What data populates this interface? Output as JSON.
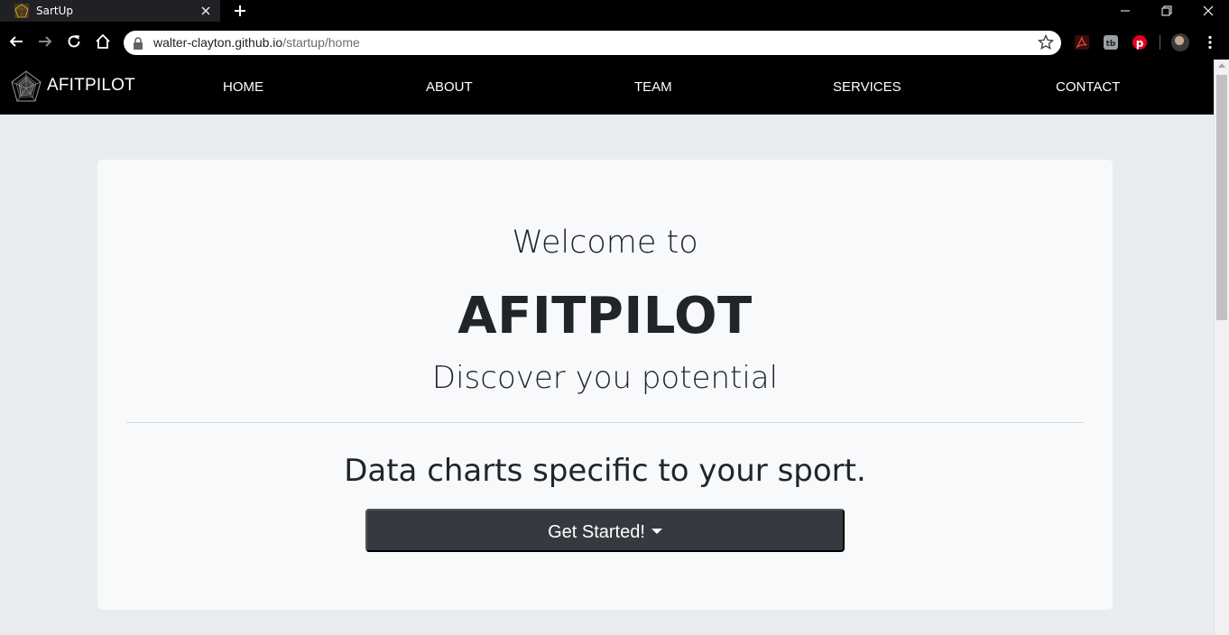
{
  "browser": {
    "tab_title": "SartUp",
    "url_host": "walter-clayton.github.io",
    "url_path": "/startup/home"
  },
  "icons": {
    "tab": [
      "site-favicon",
      "close-icon",
      "plus-icon"
    ],
    "window": [
      "minimize-icon",
      "restore-icon",
      "close-icon"
    ],
    "toolbar": [
      "back-arrow-icon",
      "forward-arrow-icon",
      "reload-icon",
      "home-icon",
      "lock-icon",
      "star-icon",
      "pdf-extension-icon",
      "tb-extension-icon",
      "pinterest-extension-icon",
      "avatar",
      "kebab-menu-icon"
    ],
    "brand": "pentagon-radar-logo"
  },
  "site": {
    "brand": "AFITPILOT",
    "nav": [
      {
        "label": "HOME"
      },
      {
        "label": "ABOUT"
      },
      {
        "label": "TEAM"
      },
      {
        "label": "SERVICES"
      },
      {
        "label": "CONTACT"
      }
    ]
  },
  "hero": {
    "pre_title": "Welcome to",
    "title": "AFITPILOT",
    "lead": "Discover you potential",
    "subtitle": "Data charts specific to your sport.",
    "cta_label": "Get Started!"
  },
  "colors": {
    "navbar_bg": "#000000",
    "page_bg": "#e9ecef",
    "jumbotron_bg": "#f8f9fa",
    "button_bg": "#343a40",
    "pinterest_red": "#e60023"
  }
}
